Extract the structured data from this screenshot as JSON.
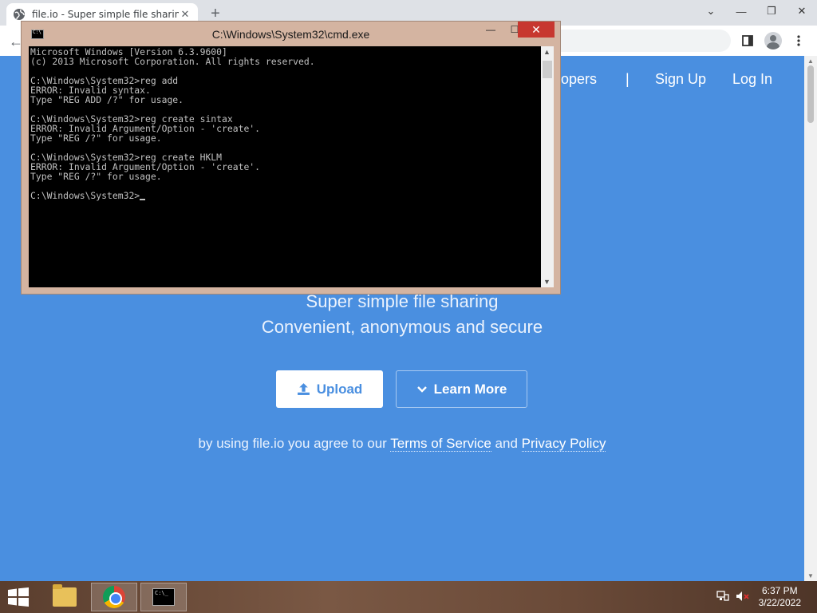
{
  "browser": {
    "tab_title": "file.io - Super simple file sharing",
    "tab_close": "✕",
    "new_tab": "+",
    "minimize": "⌄",
    "restore": "❐",
    "close": "✕",
    "back": "←"
  },
  "nav": {
    "developers_partial": "opers",
    "divider": "|",
    "sign_up": "Sign Up",
    "log_in": "Log In"
  },
  "hero": {
    "line1": "Super simple file sharing",
    "line2": "Convenient, anonymous and secure"
  },
  "buttons": {
    "upload": "Upload",
    "learn_more": "Learn More"
  },
  "terms": {
    "prefix": "by using file.io you agree to our ",
    "tos": "Terms of Service",
    "and": " and ",
    "privacy": "Privacy Policy"
  },
  "cmd": {
    "title": "C:\\Windows\\System32\\cmd.exe",
    "lines": [
      "Microsoft Windows [Version 6.3.9600]",
      "(c) 2013 Microsoft Corporation. All rights reserved.",
      "",
      "C:\\Windows\\System32>reg add",
      "ERROR: Invalid syntax.",
      "Type \"REG ADD /?\" for usage.",
      "",
      "C:\\Windows\\System32>reg create sintax",
      "ERROR: Invalid Argument/Option - 'create'.",
      "Type \"REG /?\" for usage.",
      "",
      "C:\\Windows\\System32>reg create HKLM",
      "ERROR: Invalid Argument/Option - 'create'.",
      "Type \"REG /?\" for usage.",
      ""
    ],
    "prompt": "C:\\Windows\\System32>"
  },
  "taskbar": {
    "time": "6:37 PM",
    "date": "3/22/2022"
  }
}
